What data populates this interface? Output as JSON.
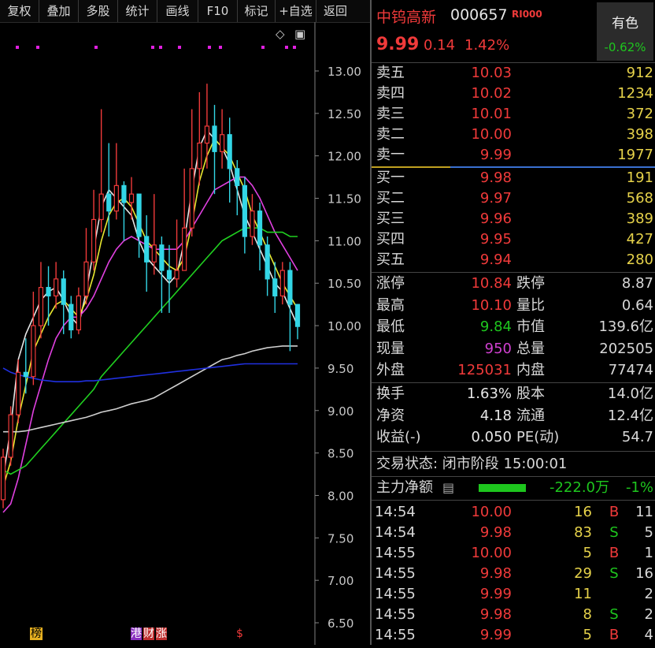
{
  "toolbar": [
    "复权",
    "叠加",
    "多股",
    "统计",
    "画线",
    "F10",
    "标记",
    "+自选",
    "返回"
  ],
  "chart_icons": {
    "diamond": "◇",
    "panel_toggle": "▣"
  },
  "axis": {
    "ticks": [
      "13.00",
      "12.50",
      "12.00",
      "11.50",
      "11.00",
      "10.50",
      "10.00",
      "9.50",
      "9.00",
      "8.50",
      "8.00",
      "7.50",
      "7.00",
      "6.50"
    ]
  },
  "markers": {
    "bang": "榜",
    "ggt": "港",
    "fin": "财",
    "zhang": "涨",
    "s": "$"
  },
  "chart_data": {
    "type": "candlestick",
    "y_axis": {
      "min": 6.5,
      "max": 13.0,
      "ticks": [
        13.0,
        12.5,
        12.0,
        11.5,
        11.0,
        10.5,
        10.0,
        9.5,
        9.0,
        8.5,
        8.0,
        7.5,
        7.0,
        6.5
      ]
    },
    "candles": [
      [
        7.95,
        8.45,
        8.55,
        7.85
      ],
      [
        8.45,
        8.95,
        9.05,
        8.35
      ],
      [
        8.95,
        9.45,
        9.6,
        8.85
      ],
      [
        9.45,
        9.4,
        9.85,
        9.2
      ],
      [
        9.4,
        10.0,
        10.4,
        9.3
      ],
      [
        10.0,
        10.45,
        10.75,
        9.85
      ],
      [
        10.45,
        10.35,
        10.7,
        10.0
      ],
      [
        10.35,
        10.55,
        10.75,
        10.2
      ],
      [
        10.55,
        10.25,
        10.65,
        9.9
      ],
      [
        10.25,
        9.95,
        10.35,
        9.85
      ],
      [
        9.95,
        10.35,
        10.45,
        9.9
      ],
      [
        10.35,
        10.75,
        11.15,
        10.25
      ],
      [
        10.75,
        11.25,
        11.6,
        10.65
      ],
      [
        11.25,
        11.55,
        12.55,
        11.1
      ],
      [
        11.55,
        11.35,
        12.15,
        11.05
      ],
      [
        11.35,
        11.65,
        12.15,
        11.25
      ],
      [
        11.65,
        11.45,
        11.7,
        11.0
      ],
      [
        11.45,
        11.55,
        11.75,
        11.25
      ],
      [
        11.55,
        11.05,
        11.55,
        10.8
      ],
      [
        11.05,
        10.75,
        11.3,
        10.4
      ],
      [
        10.75,
        10.95,
        11.55,
        10.6
      ],
      [
        10.95,
        10.65,
        11.05,
        10.15
      ],
      [
        10.65,
        10.55,
        10.95,
        10.15
      ],
      [
        10.55,
        10.65,
        11.25,
        10.45
      ],
      [
        10.65,
        11.15,
        11.85,
        10.75
      ],
      [
        11.15,
        11.85,
        12.55,
        11.05
      ],
      [
        11.85,
        12.15,
        12.75,
        11.65
      ],
      [
        12.15,
        12.35,
        12.85,
        11.85
      ],
      [
        12.35,
        12.05,
        12.6,
        11.55
      ],
      [
        12.05,
        12.25,
        12.55,
        11.85
      ],
      [
        12.25,
        11.85,
        12.45,
        11.45
      ],
      [
        11.85,
        11.65,
        11.95,
        11.3
      ],
      [
        11.65,
        11.05,
        11.75,
        10.85
      ],
      [
        11.05,
        11.35,
        11.55,
        10.95
      ],
      [
        11.35,
        10.95,
        11.45,
        10.65
      ],
      [
        10.95,
        10.55,
        11.05,
        10.35
      ],
      [
        10.55,
        10.35,
        10.75,
        10.15
      ],
      [
        10.35,
        10.65,
        10.75,
        10.25
      ],
      [
        10.65,
        10.25,
        10.75,
        9.7
      ],
      [
        10.25,
        9.99,
        10.1,
        9.84
      ]
    ],
    "ma_lines": [
      {
        "color": "#e6e6e6",
        "values": [
          8.2,
          8.8,
          9.6,
          9.9,
          10.1,
          10.3,
          10.4,
          10.45,
          10.3,
          10.1,
          10.0,
          10.4,
          10.9,
          11.4,
          11.6,
          11.5,
          11.4,
          11.3,
          11.0,
          10.8,
          10.7,
          10.6,
          10.5,
          10.6,
          11.0,
          11.6,
          12.1,
          12.3,
          12.2,
          12.1,
          11.9,
          11.6,
          11.3,
          11.1,
          10.9,
          10.7,
          10.5,
          10.4,
          10.2,
          10.0
        ]
      },
      {
        "color": "#e8e830",
        "values": [
          8.1,
          8.4,
          8.9,
          9.3,
          9.7,
          9.9,
          10.1,
          10.25,
          10.3,
          10.2,
          10.1,
          10.3,
          10.6,
          11.0,
          11.3,
          11.45,
          11.5,
          11.4,
          11.2,
          11.0,
          10.9,
          10.8,
          10.7,
          10.65,
          10.8,
          11.2,
          11.7,
          12.0,
          12.2,
          12.1,
          12.0,
          11.8,
          11.6,
          11.3,
          11.1,
          10.9,
          10.7,
          10.5,
          10.35,
          10.2
        ]
      },
      {
        "color": "#e040e0",
        "values": [
          7.8,
          7.9,
          8.2,
          8.6,
          9.0,
          9.3,
          9.6,
          9.85,
          10.0,
          10.1,
          10.1,
          10.2,
          10.35,
          10.55,
          10.75,
          10.9,
          11.0,
          11.05,
          11.0,
          10.95,
          10.9,
          10.9,
          10.9,
          10.9,
          11.0,
          11.15,
          11.3,
          11.45,
          11.6,
          11.65,
          11.7,
          11.75,
          11.75,
          11.65,
          11.5,
          11.3,
          11.1,
          10.95,
          10.8,
          10.65
        ]
      },
      {
        "color": "#20d020",
        "values": [
          8.3,
          8.25,
          8.3,
          8.35,
          8.45,
          8.55,
          8.65,
          8.75,
          8.85,
          8.95,
          9.05,
          9.15,
          9.25,
          9.4,
          9.5,
          9.6,
          9.7,
          9.8,
          9.9,
          10.0,
          10.1,
          10.2,
          10.3,
          10.4,
          10.5,
          10.6,
          10.7,
          10.8,
          10.9,
          11.0,
          11.05,
          11.1,
          11.15,
          11.15,
          11.15,
          11.1,
          11.1,
          11.1,
          11.05,
          11.05
        ]
      },
      {
        "color": "#cfcfcf",
        "values": [
          8.75,
          8.75,
          8.75,
          8.76,
          8.78,
          8.8,
          8.82,
          8.84,
          8.86,
          8.88,
          8.9,
          8.92,
          8.95,
          8.98,
          9.0,
          9.02,
          9.05,
          9.08,
          9.1,
          9.12,
          9.15,
          9.2,
          9.25,
          9.3,
          9.35,
          9.4,
          9.45,
          9.5,
          9.55,
          9.6,
          9.62,
          9.65,
          9.67,
          9.7,
          9.72,
          9.74,
          9.75,
          9.76,
          9.76,
          9.76
        ]
      },
      {
        "color": "#2030e0",
        "values": [
          9.5,
          9.45,
          9.42,
          9.4,
          9.38,
          9.36,
          9.35,
          9.34,
          9.34,
          9.34,
          9.34,
          9.35,
          9.35,
          9.36,
          9.37,
          9.38,
          9.39,
          9.4,
          9.41,
          9.42,
          9.43,
          9.44,
          9.45,
          9.46,
          9.47,
          9.48,
          9.49,
          9.5,
          9.51,
          9.52,
          9.53,
          9.54,
          9.55,
          9.55,
          9.55,
          9.55,
          9.55,
          9.55,
          9.55,
          9.55
        ]
      }
    ]
  },
  "header": {
    "name": "中钨高新",
    "code": "000657",
    "r_badge": "RI000",
    "price": "9.99",
    "change": "0.14",
    "pct": "1.42%",
    "sector_name": "有色",
    "sector_pct": "-0.62%"
  },
  "asks": [
    {
      "label": "卖五",
      "price": "10.03",
      "vol": "912"
    },
    {
      "label": "卖四",
      "price": "10.02",
      "vol": "1234"
    },
    {
      "label": "卖三",
      "price": "10.01",
      "vol": "372"
    },
    {
      "label": "卖二",
      "price": "10.00",
      "vol": "398"
    },
    {
      "label": "卖一",
      "price": "9.99",
      "vol": "1977"
    }
  ],
  "bids": [
    {
      "label": "买一",
      "price": "9.98",
      "vol": "191"
    },
    {
      "label": "买二",
      "price": "9.97",
      "vol": "568"
    },
    {
      "label": "买三",
      "price": "9.96",
      "vol": "389"
    },
    {
      "label": "买四",
      "price": "9.95",
      "vol": "427"
    },
    {
      "label": "买五",
      "price": "9.94",
      "vol": "280"
    }
  ],
  "stats1": [
    {
      "k1": "涨停",
      "v1": "10.84",
      "c1": "red",
      "k2": "跌停",
      "v2": "8.87",
      "c2": "green"
    },
    {
      "k1": "最高",
      "v1": "10.10",
      "c1": "red",
      "k2": "量比",
      "v2": "0.64",
      "c2": "green"
    },
    {
      "k1": "最低",
      "v1": "9.84",
      "c1": "green",
      "k2": "市值",
      "v2": "139.6亿",
      "c2": "white"
    },
    {
      "k1": "现量",
      "v1": "950",
      "c1": "purple",
      "k2": "总量",
      "v2": "202505",
      "c2": "white"
    },
    {
      "k1": "外盘",
      "v1": "125031",
      "c1": "red",
      "k2": "内盘",
      "v2": "77474",
      "c2": "green"
    }
  ],
  "stats2": [
    {
      "k1": "换手",
      "v1": "1.63%",
      "c1": "white",
      "k2": "股本",
      "v2": "14.0亿",
      "c2": "white"
    },
    {
      "k1": "净资",
      "v1": "4.18",
      "c1": "white",
      "k2": "流通",
      "v2": "12.4亿",
      "c2": "white"
    },
    {
      "k1": "收益(-)",
      "v1": "0.050",
      "c1": "white",
      "k2": "PE(动)",
      "v2": "54.7",
      "c2": "white"
    }
  ],
  "trade_status": "交易状态: 闭市阶段 15:00:01",
  "capital": {
    "label": "主力净额",
    "icon": "▤",
    "value": "-222.0万",
    "pct": "-1%",
    "bar_fraction": 0.6
  },
  "ticks": [
    {
      "time": "14:54",
      "price": "10.00",
      "vol": "16",
      "bs": "B",
      "n": "11"
    },
    {
      "time": "14:54",
      "price": "9.98",
      "vol": "83",
      "bs": "S",
      "n": "5"
    },
    {
      "time": "14:55",
      "price": "10.00",
      "vol": "5",
      "bs": "B",
      "n": "1"
    },
    {
      "time": "14:55",
      "price": "9.98",
      "vol": "29",
      "bs": "S",
      "n": "16"
    },
    {
      "time": "14:55",
      "price": "9.99",
      "vol": "11",
      "bs": "",
      "n": "2"
    },
    {
      "time": "14:55",
      "price": "9.98",
      "vol": "8",
      "bs": "S",
      "n": "2"
    },
    {
      "time": "14:55",
      "price": "9.99",
      "vol": "5",
      "bs": "B",
      "n": "4"
    }
  ]
}
